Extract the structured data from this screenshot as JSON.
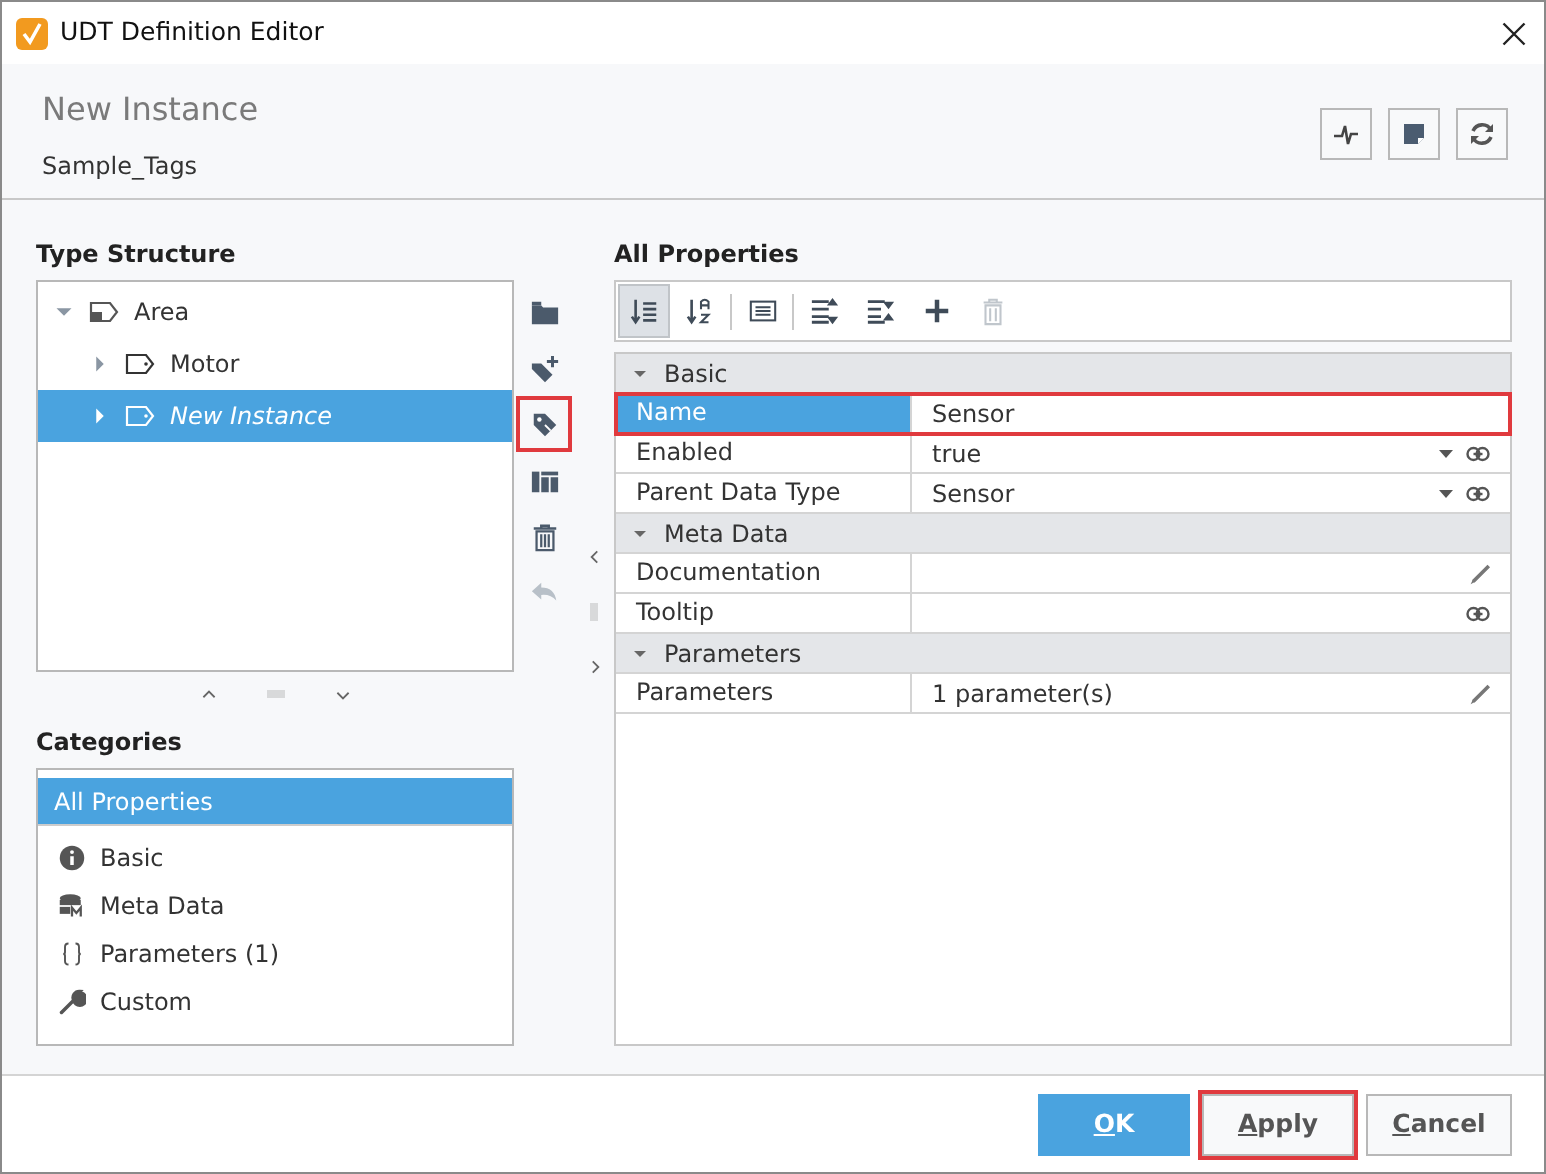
{
  "window": {
    "title": "UDT Definition Editor"
  },
  "header": {
    "title": "New Instance",
    "subtitle": "Sample_Tags"
  },
  "type_structure": {
    "title": "Type Structure",
    "tree": [
      {
        "label": "Area",
        "kind": "folder",
        "expanded": true,
        "selected": false,
        "italic": false,
        "children": [
          {
            "label": "Motor",
            "kind": "instance",
            "expanded": false,
            "selected": false,
            "italic": false
          },
          {
            "label": "New Instance",
            "kind": "instance",
            "expanded": false,
            "selected": true,
            "italic": true
          }
        ]
      }
    ]
  },
  "side_toolbar": [
    {
      "highlighted": false,
      "disabled": false
    },
    {
      "highlighted": false,
      "disabled": false
    },
    {
      "highlighted": true,
      "disabled": false
    },
    {
      "highlighted": false,
      "disabled": false
    },
    {
      "highlighted": false,
      "disabled": false
    },
    {
      "highlighted": false,
      "disabled": true
    }
  ],
  "categories": {
    "title": "Categories",
    "items": [
      {
        "label": "All Properties",
        "selected": true
      },
      {
        "label": "Basic",
        "selected": false
      },
      {
        "label": "Meta Data",
        "selected": false
      },
      {
        "label": "Parameters (1)",
        "selected": false
      },
      {
        "label": "Custom",
        "selected": false
      }
    ]
  },
  "properties": {
    "title": "All Properties",
    "toolbar": [
      {
        "selected": true,
        "disabled": false
      },
      {
        "selected": false,
        "disabled": false
      },
      {
        "selected": false,
        "disabled": false
      },
      {
        "selected": false,
        "disabled": false
      },
      {
        "selected": false,
        "disabled": false
      },
      {
        "selected": false,
        "disabled": false
      },
      {
        "selected": false,
        "disabled": true
      }
    ],
    "groups": [
      {
        "label": "Basic",
        "expanded": true,
        "rows": [
          {
            "name": "Name",
            "value": "Sensor",
            "kind": "input",
            "selected": true,
            "highlighted": true
          },
          {
            "name": "Enabled",
            "value": "true",
            "kind": "choice",
            "selected": false,
            "highlighted": false
          },
          {
            "name": "Parent Data Type",
            "value": "Sensor",
            "kind": "choice",
            "selected": false,
            "highlighted": false
          }
        ]
      },
      {
        "label": "Meta Data",
        "expanded": true,
        "rows": [
          {
            "name": "Documentation",
            "kind": "edit",
            "selected": false,
            "highlighted": false
          },
          {
            "name": "Tooltip",
            "kind": "link",
            "selected": false,
            "highlighted": false
          }
        ]
      },
      {
        "label": "Parameters",
        "expanded": true,
        "rows": [
          {
            "name": "Parameters",
            "value": "1 parameter(s)",
            "kind": "edit",
            "selected": false,
            "highlighted": false
          }
        ]
      }
    ]
  },
  "buttons": [
    {
      "label": "OK",
      "primary": true,
      "highlighted": false,
      "underline_first": true
    },
    {
      "label": "Apply",
      "primary": false,
      "highlighted": true,
      "underline_first": true
    },
    {
      "label": "Cancel",
      "primary": false,
      "highlighted": false,
      "underline_first": true
    }
  ]
}
